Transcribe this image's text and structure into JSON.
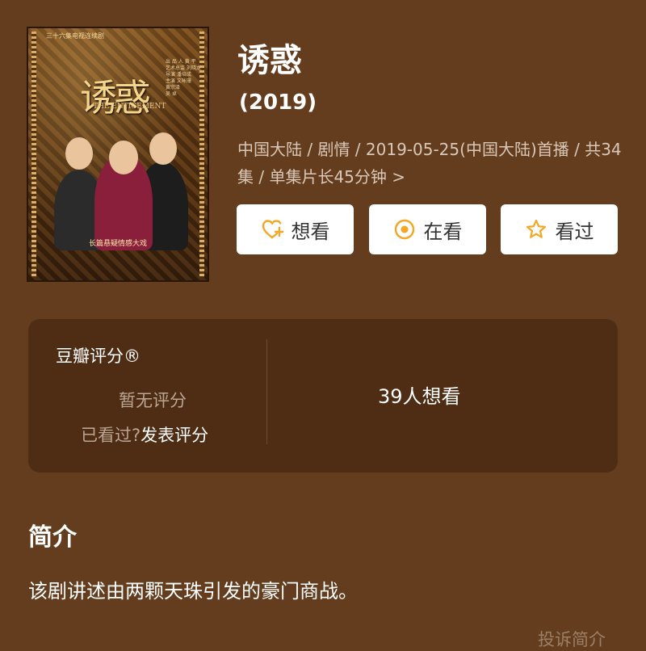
{
  "poster": {
    "tagline": "三十六集电视连续剧",
    "logo": "诱惑",
    "english_title": "THE ENTICEMENT",
    "subtitle": "长篇悬疑情感大戏",
    "credits": [
      "出 品 人 黄 平",
      "艺术总监 刘晓龙",
      "导演 潘培成",
      "主演 文咏珊",
      "黄宗泽",
      "吴 卓"
    ]
  },
  "movie": {
    "title": "诱惑",
    "year": "(2019)",
    "meta": "中国大陆 / 剧情 / 2019-05-25(中国大陆)首播 / 共34集 / 单集片长45分钟 >"
  },
  "actions": {
    "want": "想看",
    "watching": "在看",
    "watched": "看过"
  },
  "rating": {
    "header": "豆瓣评分®",
    "no_rating": "暂无评分",
    "seen_prefix": "已看过?",
    "post_rating": "发表评分",
    "want_count": "39人想看"
  },
  "intro": {
    "title": "简介",
    "text": "该剧讲述由两颗天珠引发的豪门商战。",
    "report": "投诉简介"
  },
  "colors": {
    "background": "#643d1e",
    "card": "#4e2d14",
    "accent": "#f5a623"
  }
}
